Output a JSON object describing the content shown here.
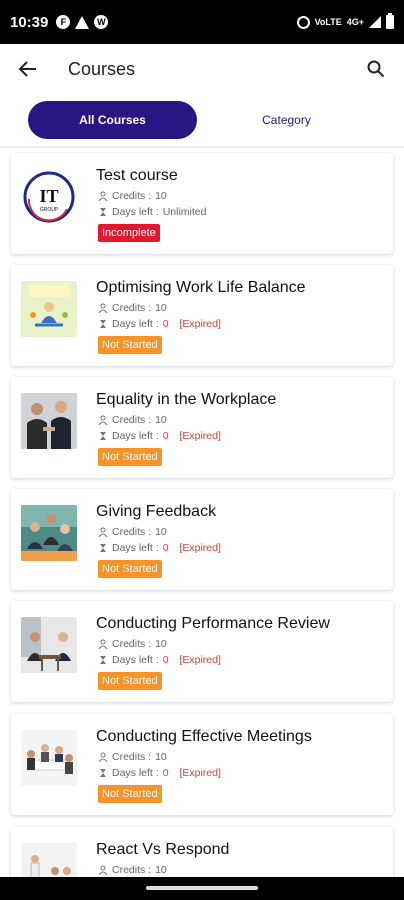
{
  "status_bar": {
    "time": "10:39",
    "left_icons": [
      "F",
      "!",
      "W"
    ],
    "network_label": "4G+",
    "carrier_label": "VoLTE"
  },
  "app_bar": {
    "title": "Courses"
  },
  "tabs": [
    {
      "label": "All Courses",
      "active": true
    },
    {
      "label": "Category",
      "active": false
    }
  ],
  "courses": [
    {
      "title": "Test course",
      "credits_label": "Credits : ",
      "credits": "10",
      "days_label": "Days left :",
      "days_value": "Unlimited",
      "expired_text": "",
      "status": "Incomplete",
      "status_color": "#e0192e",
      "thumb": "it-group-logo"
    },
    {
      "title": "Optimising Work Life Balance",
      "credits_label": "Credits : ",
      "credits": "10",
      "days_label": "Days left : ",
      "days_value": "0",
      "expired_text": "[Expired]",
      "status": "Not Started",
      "status_color": "#f7932a",
      "thumb": "meditation-illustration"
    },
    {
      "title": "Equality in the Workplace",
      "credits_label": "Credits : ",
      "credits": "10",
      "days_label": "Days left : ",
      "days_value": "0",
      "expired_text": "[Expired]",
      "status": "Not Started",
      "status_color": "#f7932a",
      "thumb": "handshake-photo"
    },
    {
      "title": "Giving Feedback",
      "credits_label": "Credits : ",
      "credits": "10",
      "days_label": "Days left : ",
      "days_value": "0",
      "expired_text": "[Expired]",
      "status": "Not Started",
      "status_color": "#f7932a",
      "thumb": "meeting-photo"
    },
    {
      "title": "Conducting Performance Review",
      "credits_label": "Credits : ",
      "credits": "10",
      "days_label": "Days left : ",
      "days_value": "0",
      "expired_text": "[Expired]",
      "status": "Not Started",
      "status_color": "#f7932a",
      "thumb": "interview-photo"
    },
    {
      "title": "Conducting Effective Meetings",
      "credits_label": "Credits : ",
      "credits": "10",
      "days_label": "Days left : ",
      "days_value": "0",
      "expired_text": "[Expired]",
      "status": "Not Started",
      "status_color": "#f7932a",
      "thumb": "conference-photo"
    },
    {
      "title": "React Vs Respond",
      "credits_label": "Credits : ",
      "credits": "10",
      "days_label": "",
      "days_value": "",
      "expired_text": "",
      "status": "",
      "status_color": "#f7932a",
      "thumb": "presenter-photo"
    }
  ],
  "colors": {
    "primary": "#2a1585",
    "incomplete": "#e0192e",
    "not_started": "#f7932a",
    "expired": "#e53935"
  }
}
